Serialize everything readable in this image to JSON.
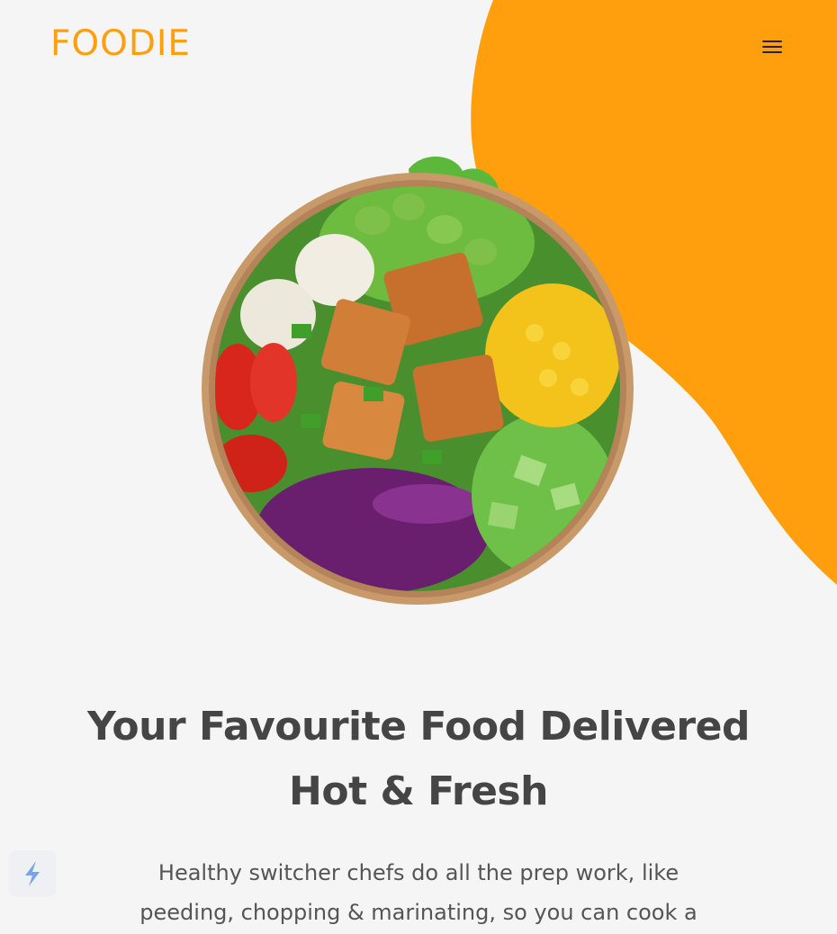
{
  "brand": {
    "name": "FOODIE",
    "accent_color": "#FF9F0D"
  },
  "header": {
    "menu_icon": "hamburger-menu-icon"
  },
  "hero": {
    "image_icon": "salad-bowl-image",
    "title_line1": "Your Favourite Food Delivered",
    "title_line2": "Hot & Fresh",
    "description": "Healthy switcher chefs do all the prep work, like peeding, chopping & marinating, so you can cook a"
  },
  "widget": {
    "icon": "lightning-bolt-icon"
  }
}
